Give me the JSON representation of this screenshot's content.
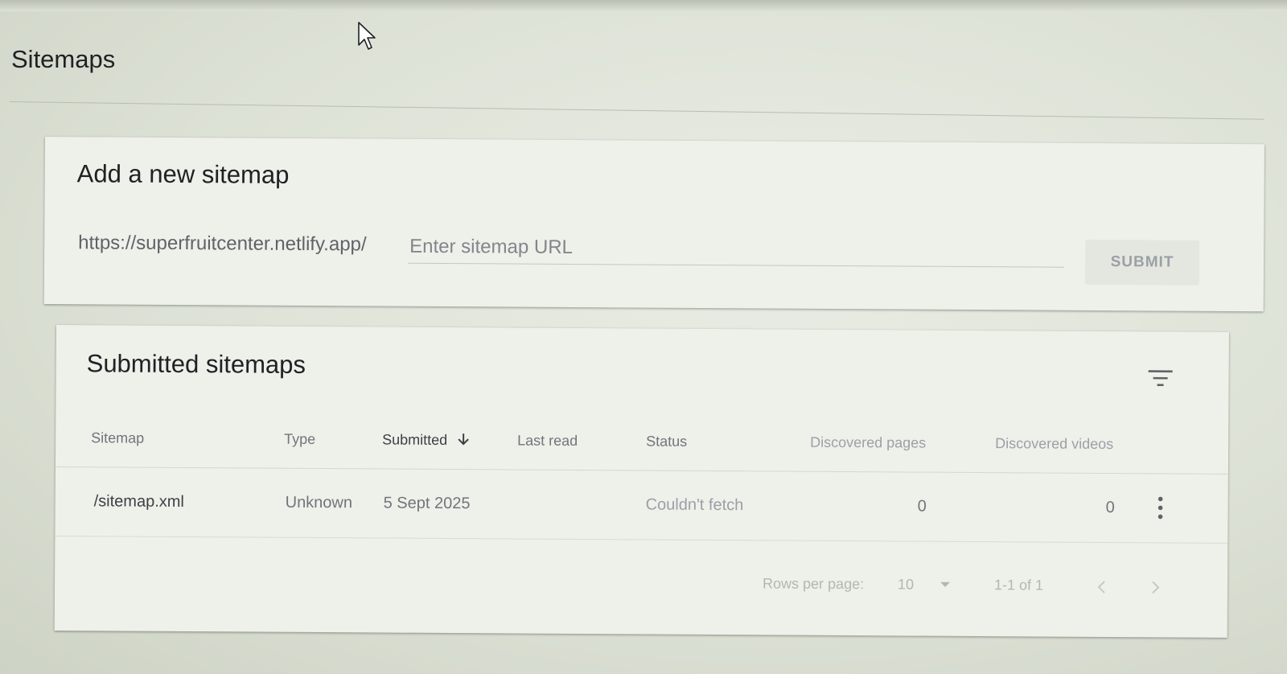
{
  "page": {
    "title": "Sitemaps"
  },
  "add_sitemap": {
    "title": "Add a new sitemap",
    "url_prefix": "https://superfruitcenter.netlify.app/",
    "input_placeholder": "Enter sitemap URL",
    "input_value": "",
    "submit_label": "SUBMIT"
  },
  "submitted": {
    "title": "Submitted sitemaps",
    "columns": {
      "sitemap": "Sitemap",
      "type": "Type",
      "submitted": "Submitted",
      "last_read": "Last read",
      "status": "Status",
      "discovered_pages": "Discovered pages",
      "discovered_videos": "Discovered videos"
    },
    "rows": [
      {
        "sitemap": "/sitemap.xml",
        "type": "Unknown",
        "submitted": "5 Sept 2025",
        "last_read": "",
        "status": "Couldn't fetch",
        "discovered_pages": "0",
        "discovered_videos": "0"
      }
    ],
    "pagination": {
      "rows_per_page_label": "Rows per page:",
      "rows_per_page_value": "10",
      "range_text": "1-1 of 1"
    }
  },
  "icons": {
    "cursor": "mouse-pointer-icon",
    "filter": "filter-icon",
    "sort": "arrow-down-icon",
    "more": "more-vert-icon",
    "prev": "chevron-left-icon",
    "next": "chevron-right-icon"
  },
  "colors": {
    "status_error": "#9aa0a6",
    "text_primary": "#202124"
  }
}
